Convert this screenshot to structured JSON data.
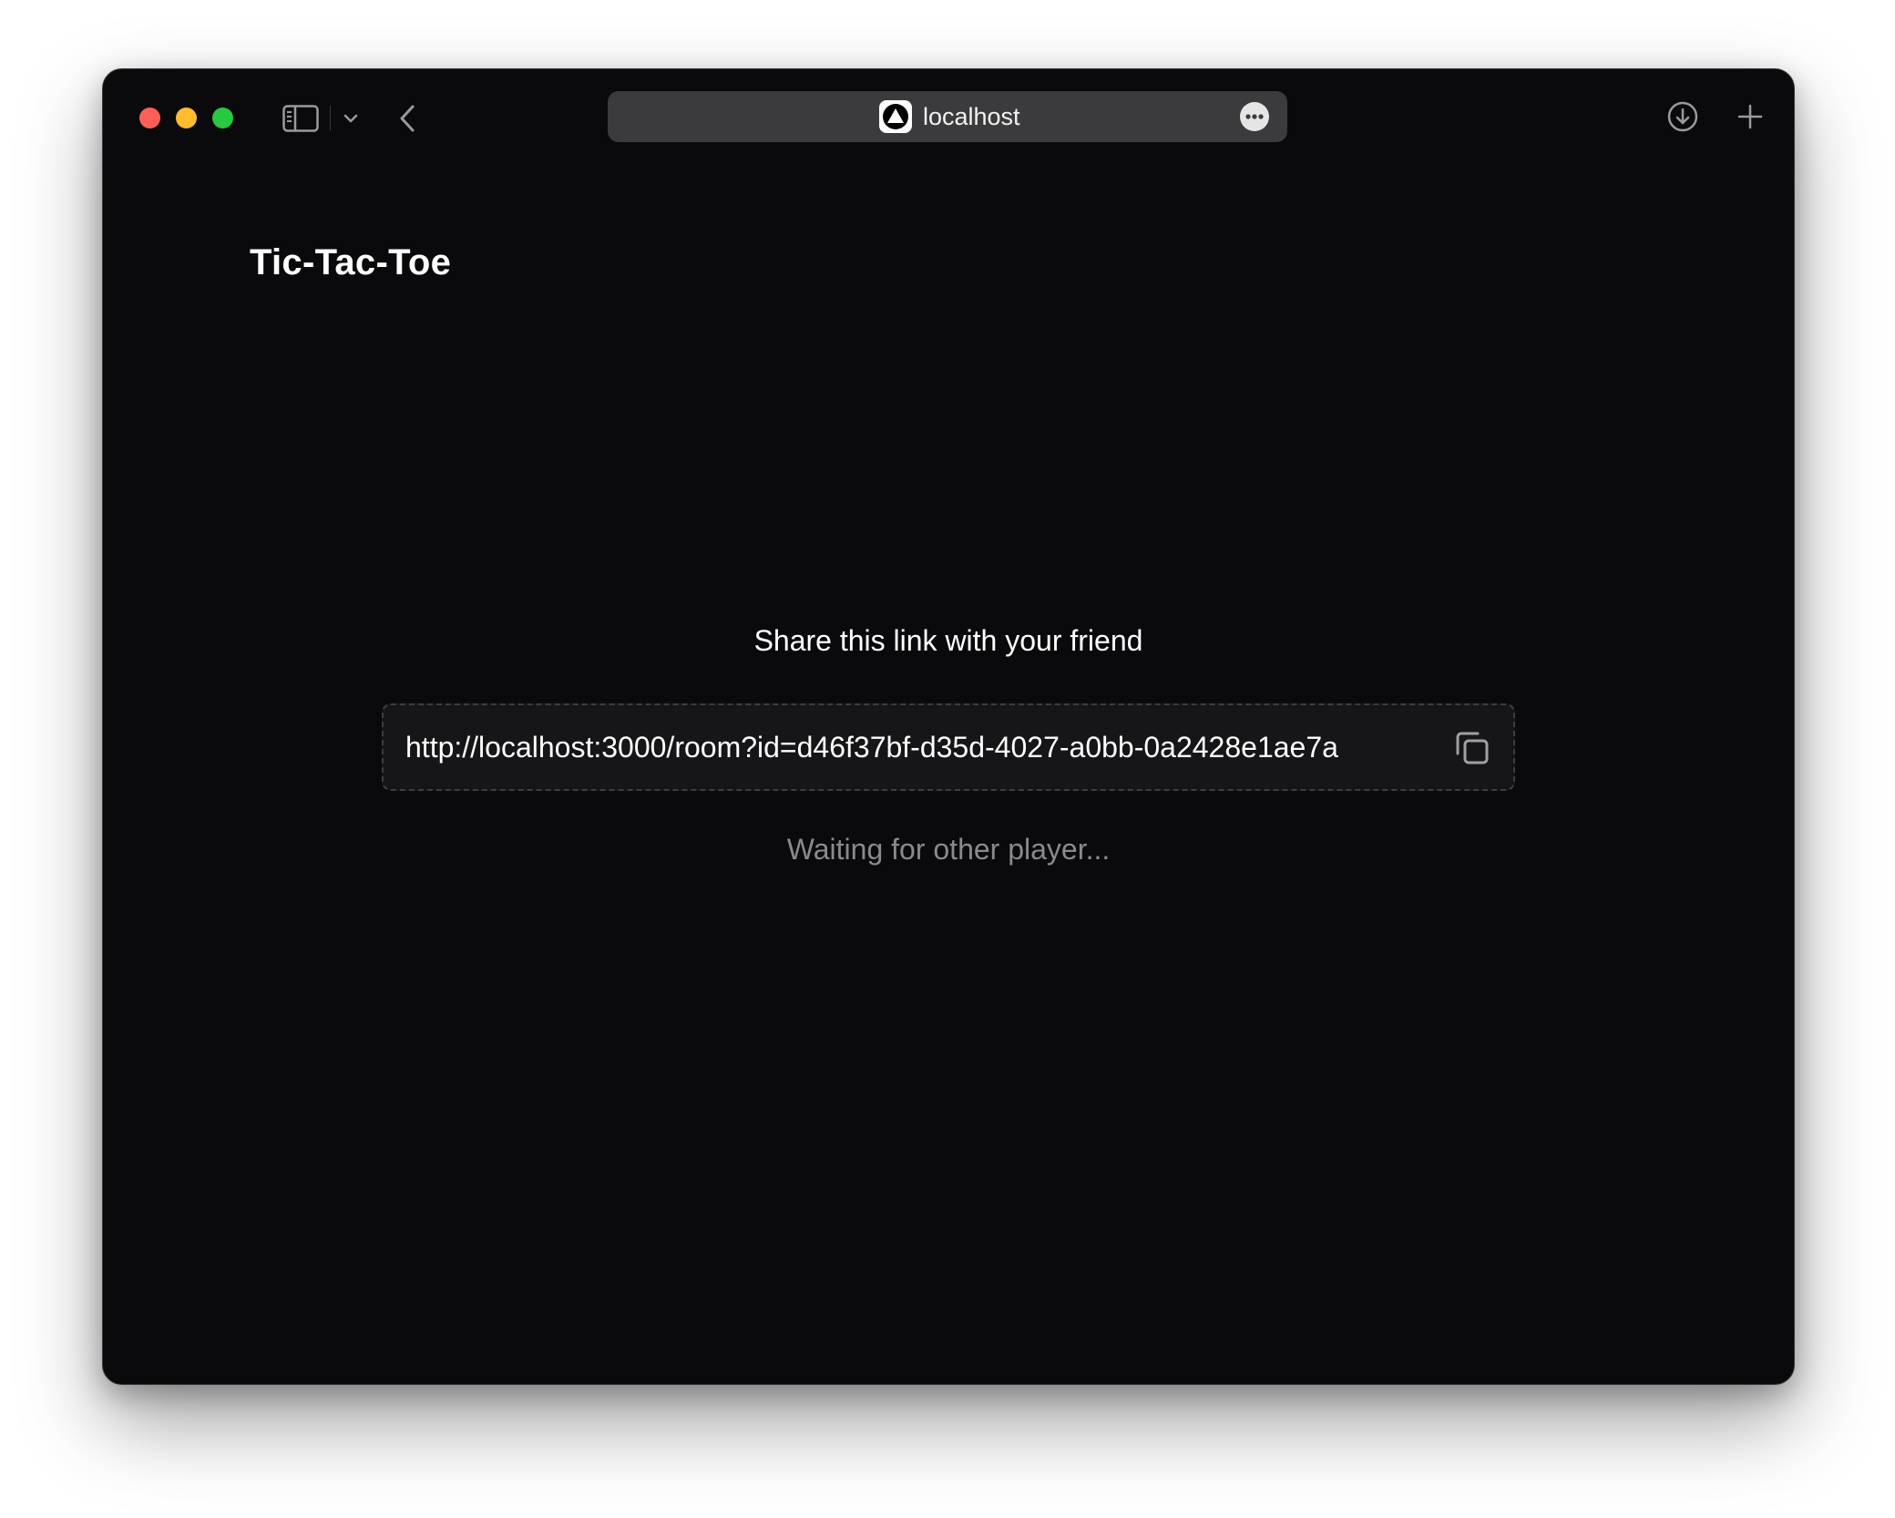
{
  "browser": {
    "address": "localhost",
    "icons": {
      "sidebar": "sidebar-icon",
      "tab_overview": "chevron-down-icon",
      "back": "chevron-left-icon",
      "favicon": "triangle-logo-icon",
      "page_menu": "ellipsis-icon",
      "downloads": "download-icon",
      "new_tab": "plus-icon"
    },
    "traffic_lights": {
      "close": "#ff5f57",
      "minimize": "#febc2e",
      "maximize": "#28c840"
    }
  },
  "app": {
    "title": "Tic-Tac-Toe"
  },
  "share": {
    "label": "Share this link with your friend",
    "link": "http://localhost:3000/room?id=d46f37bf-d35d-4027-a0bb-0a2428e1ae7a",
    "copy_icon": "copy-icon"
  },
  "status": {
    "waiting": "Waiting for other player..."
  },
  "colors": {
    "background": "#0a0a0c",
    "link_box": "#161618",
    "muted_text": "#8a8a8e"
  }
}
